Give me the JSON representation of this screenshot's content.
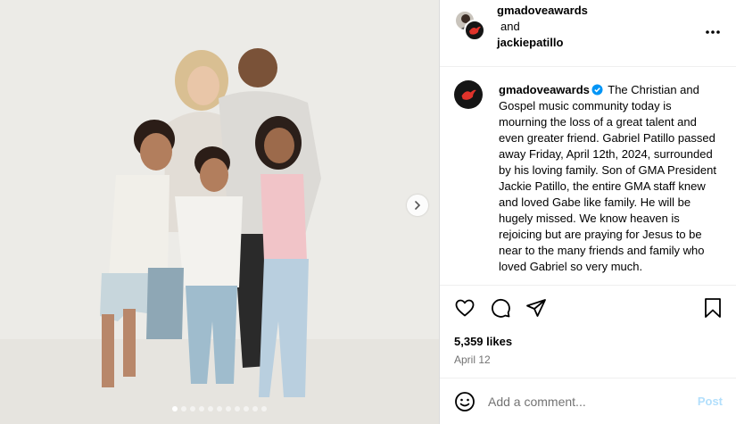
{
  "header": {
    "user1": "gmadoveawards",
    "joiner": "and",
    "user2": "jackiepatillo"
  },
  "caption": {
    "username": "gmadoveawards",
    "text": "The Christian and Gospel music community today is mourning the loss of a great talent and even greater friend. Gabriel Patillo passed away Friday, April 12th, 2024, surrounded by his loving family. Son of GMA President Jackie Patillo, the entire GMA staff knew and loved Gabe like family. He will be hugely missed. We know heaven is rejoicing but are praying for Jesus to be near to the many friends and family who loved Gabriel so very much."
  },
  "stats": {
    "likes": "5,359 likes",
    "date": "April 12"
  },
  "comment": {
    "placeholder": "Add a comment...",
    "post_label": "Post"
  },
  "carousel": {
    "count": 11,
    "active_index": 0
  },
  "colors": {
    "accent": "#0095f6",
    "post_disabled": "#b2dffc",
    "dove_red": "#e0332b"
  }
}
